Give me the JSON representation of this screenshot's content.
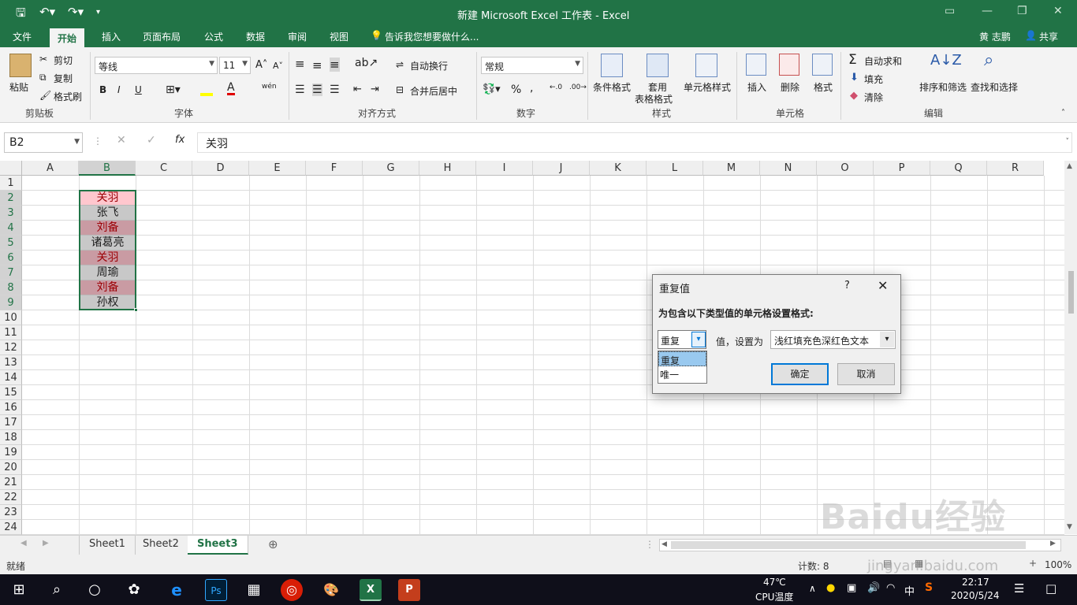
{
  "app": {
    "title": "新建 Microsoft Excel 工作表 - Excel",
    "user": "黄 志鹏",
    "share": "共享",
    "colors": {
      "brand": "#217346",
      "dup_fill": "#ffc7ce",
      "dup_text": "#9c0006"
    }
  },
  "tabs": [
    "文件",
    "开始",
    "插入",
    "页面布局",
    "公式",
    "数据",
    "审阅",
    "视图"
  ],
  "active_tab": "开始",
  "tell_me": "告诉我您想要做什么...",
  "ribbon": {
    "clipboard": {
      "paste": "粘贴",
      "cut": "剪切",
      "copy": "复制",
      "format_painter": "格式刷",
      "group": "剪贴板"
    },
    "font": {
      "name": "等线",
      "size": "11",
      "bold": "B",
      "italic": "I",
      "underline": "U",
      "phonetic": "wén",
      "group": "字体"
    },
    "alignment": {
      "wrap": "自动换行",
      "merge": "合并后居中",
      "group": "对齐方式"
    },
    "number": {
      "format": "常规",
      "group": "数字"
    },
    "styles": {
      "cond": "条件格式",
      "table1": "套用",
      "table2": "表格格式",
      "cell_styles": "单元格样式",
      "group": "样式"
    },
    "cells": {
      "insert": "插入",
      "delete": "删除",
      "format": "格式",
      "group": "单元格"
    },
    "editing": {
      "autosum": "自动求和",
      "fill": "填充",
      "clear": "清除",
      "sort": "排序和筛选",
      "find": "查找和选择",
      "group": "编辑"
    }
  },
  "formula_bar": {
    "name_box": "B2",
    "fx": "fx",
    "value": "关羽"
  },
  "columns": [
    "A",
    "B",
    "C",
    "D",
    "E",
    "F",
    "G",
    "H",
    "I",
    "J",
    "K",
    "L",
    "M",
    "N",
    "O",
    "P",
    "Q",
    "R"
  ],
  "rows": [
    "1",
    "2",
    "3",
    "4",
    "5",
    "6",
    "7",
    "8",
    "9",
    "10",
    "11",
    "12",
    "13",
    "14",
    "15",
    "16",
    "17",
    "18",
    "19",
    "20",
    "21",
    "22",
    "23",
    "24"
  ],
  "cells_b": [
    "关羽",
    "张飞",
    "刘备",
    "诸葛亮",
    "关羽",
    "周瑜",
    "刘备",
    "孙权"
  ],
  "sheets": [
    "Sheet1",
    "Sheet2",
    "Sheet3"
  ],
  "active_sheet": "Sheet3",
  "status": {
    "mode": "就绪",
    "count": "计数: 8",
    "zoom": "100%"
  },
  "dialog": {
    "title": "重复值",
    "help": "?",
    "prompt": "为包含以下类型值的单元格设置格式:",
    "type_value": "重复",
    "options": [
      "重复",
      "唯一"
    ],
    "mid_label": "值，设置为",
    "format_value": "浅红填充色深红色文本",
    "ok": "确定",
    "cancel": "取消"
  },
  "taskbar": {
    "temp": "47℃",
    "temp_label": "CPU温度",
    "ime": "中",
    "time": "22:17",
    "date": "2020/5/24"
  },
  "watermark": "Baidu经验 jingyan.baidu.com"
}
